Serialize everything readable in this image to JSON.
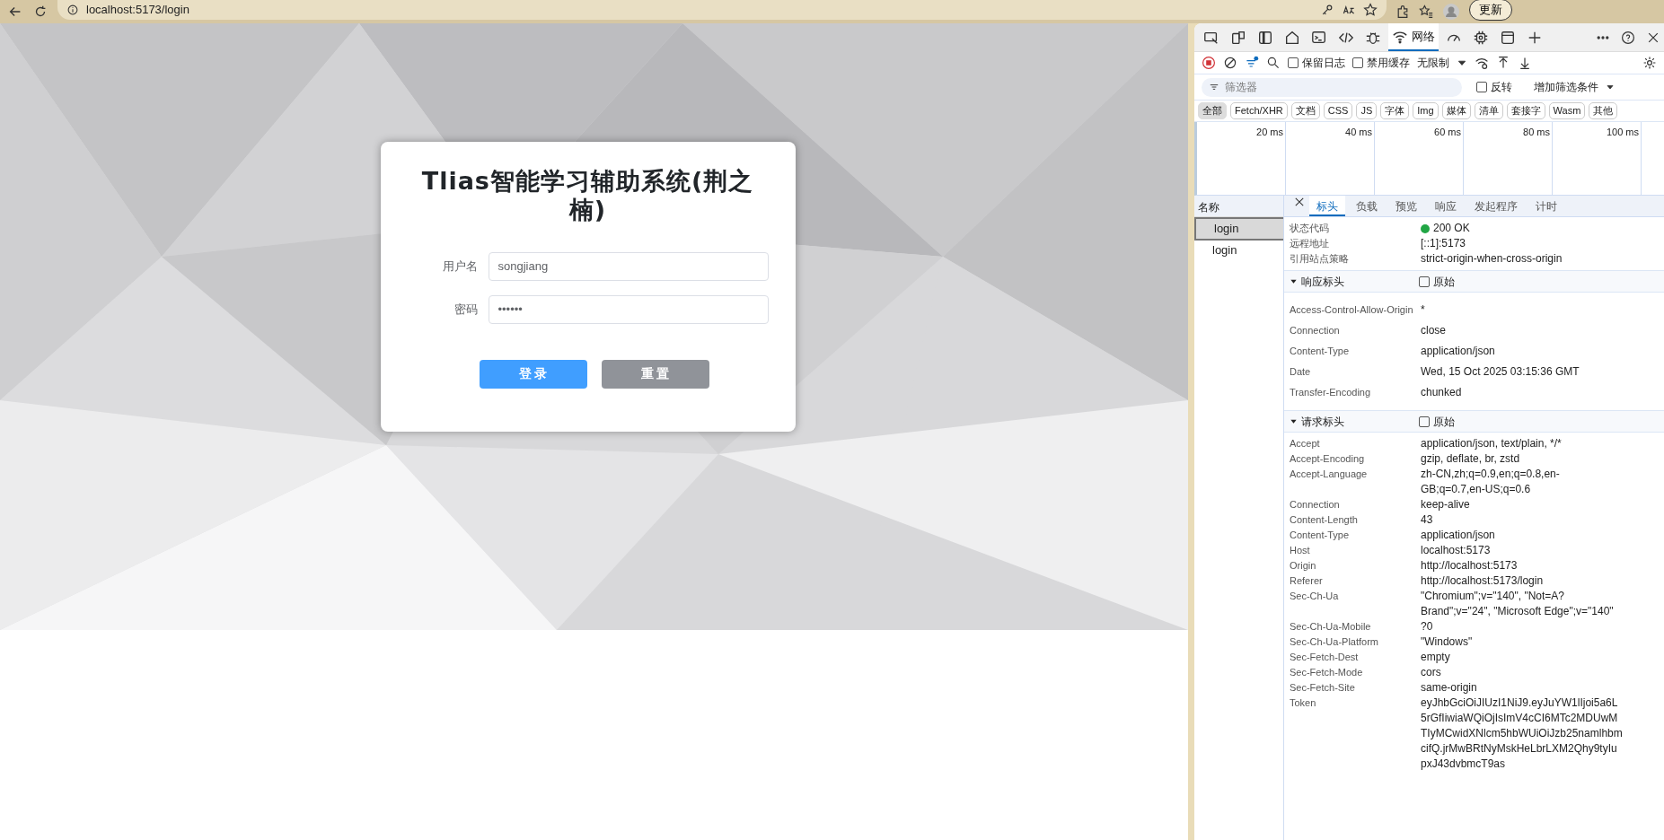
{
  "browser": {
    "url": "localhost:5173/login",
    "update_button": "更新"
  },
  "login": {
    "title": "Tlias智能学习辅助系统(荆之楠)",
    "fields": [
      {
        "label": "用户名",
        "value": "songjiang"
      },
      {
        "label": "密码",
        "value": "••••••"
      }
    ],
    "buttons": [
      {
        "label": "登 录",
        "kind": "primary"
      },
      {
        "label": "重 置",
        "kind": "secondary"
      }
    ]
  },
  "devtools": {
    "active_tab": "网络",
    "toolbar": {
      "checkboxes": [
        {
          "label": "保留日志",
          "checked": false
        },
        {
          "label": "禁用缓存",
          "checked": false
        }
      ],
      "throttle": "无限制"
    },
    "filter": {
      "placeholder": "筛选器",
      "invert": {
        "label": "反转",
        "checked": false
      },
      "more_filters": "增加筛选条件"
    },
    "types": [
      {
        "label": "全部",
        "selected": true
      },
      {
        "label": "Fetch/XHR",
        "selected": false
      },
      {
        "label": "文档",
        "selected": false
      },
      {
        "label": "CSS",
        "selected": false
      },
      {
        "label": "JS",
        "selected": false
      },
      {
        "label": "字体",
        "selected": false
      },
      {
        "label": "Img",
        "selected": false
      },
      {
        "label": "媒体",
        "selected": false
      },
      {
        "label": "清单",
        "selected": false
      },
      {
        "label": "套接字",
        "selected": false
      },
      {
        "label": "Wasm",
        "selected": false
      },
      {
        "label": "其他",
        "selected": false
      }
    ],
    "timeline_ticks": [
      "20 ms",
      "40 ms",
      "60 ms",
      "80 ms",
      "100 ms"
    ],
    "requests": {
      "header": "名称",
      "items": [
        {
          "name": "login",
          "selected": true
        },
        {
          "name": "login",
          "selected": false
        }
      ]
    },
    "detail_tabs": [
      {
        "label": "标头",
        "selected": true
      },
      {
        "label": "负载",
        "selected": false
      },
      {
        "label": "预览",
        "selected": false
      },
      {
        "label": "响应",
        "selected": false
      },
      {
        "label": "发起程序",
        "selected": false
      },
      {
        "label": "计时",
        "selected": false
      }
    ],
    "general": [
      {
        "name": "状态代码",
        "value": "200 OK",
        "kind": "status"
      },
      {
        "name": "远程地址",
        "value": "[::1]:5173",
        "kind": "text"
      },
      {
        "name": "引用站点策略",
        "value": "strict-origin-when-cross-origin",
        "kind": "text"
      }
    ],
    "sections": [
      {
        "title": "响应标头",
        "expanded": true,
        "raw": {
          "label": "原始",
          "checked": false
        },
        "headers": [
          {
            "name": "Access-Control-Allow-Origin",
            "value": "*"
          },
          {
            "name": "Connection",
            "value": "close"
          },
          {
            "name": "Content-Type",
            "value": "application/json"
          },
          {
            "name": "Date",
            "value": "Wed, 15 Oct 2025 03:15:36 GMT"
          },
          {
            "name": "Transfer-Encoding",
            "value": "chunked"
          }
        ]
      },
      {
        "title": "请求标头",
        "expanded": true,
        "raw": {
          "label": "原始",
          "checked": false
        },
        "headers": [
          {
            "name": "Accept",
            "value": "application/json, text/plain, */*"
          },
          {
            "name": "Accept-Encoding",
            "value": "gzip, deflate, br, zstd"
          },
          {
            "name": "Accept-Language",
            "value": "zh-CN,zh;q=0.9,en;q=0.8,en-GB;q=0.7,en-US;q=0.6"
          },
          {
            "name": "Connection",
            "value": "keep-alive"
          },
          {
            "name": "Content-Length",
            "value": "43"
          },
          {
            "name": "Content-Type",
            "value": "application/json"
          },
          {
            "name": "Host",
            "value": "localhost:5173"
          },
          {
            "name": "Origin",
            "value": "http://localhost:5173"
          },
          {
            "name": "Referer",
            "value": "http://localhost:5173/login"
          },
          {
            "name": "Sec-Ch-Ua",
            "value": "\"Chromium\";v=\"140\", \"Not=A?Brand\";v=\"24\", \"Microsoft Edge\";v=\"140\""
          },
          {
            "name": "Sec-Ch-Ua-Mobile",
            "value": "?0"
          },
          {
            "name": "Sec-Ch-Ua-Platform",
            "value": "\"Windows\""
          },
          {
            "name": "Sec-Fetch-Dest",
            "value": "empty"
          },
          {
            "name": "Sec-Fetch-Mode",
            "value": "cors"
          },
          {
            "name": "Sec-Fetch-Site",
            "value": "same-origin"
          },
          {
            "name": "Token",
            "value": "eyJhbGciOiJIUzI1NiJ9.eyJuYW1lIjoi5a6L5rGfIiwiaWQiOjIsImV4cCI6MTc2MDUwMTIyMCwidXNlcm5hbWUiOiJzb25namlhbmcifQ.jrMwBRtNyMskHeLbrLXM2Qhy9tyIupxJ43dvbmcT9as"
          }
        ]
      }
    ]
  }
}
